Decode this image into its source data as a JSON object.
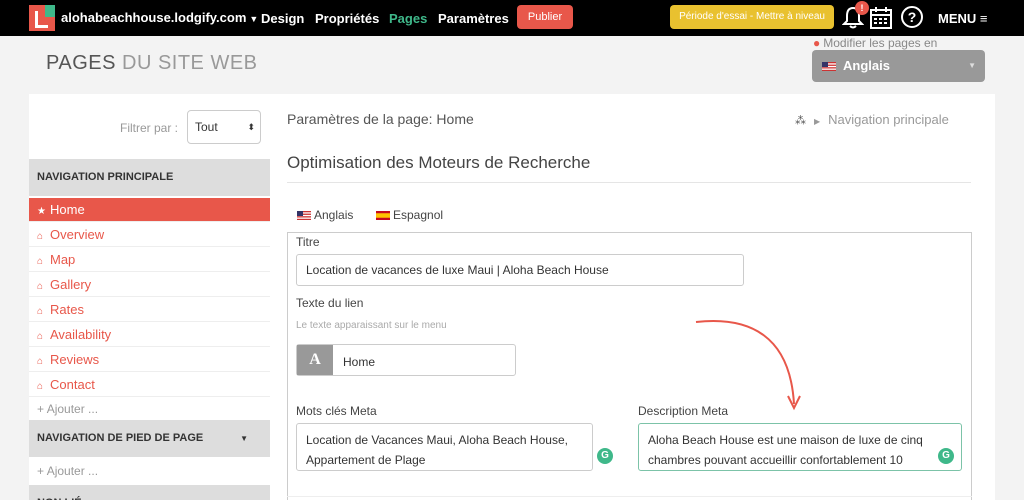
{
  "topbar": {
    "site": "alohabeachhouse.lodgify.com",
    "nav": [
      "Design",
      "Propriétés",
      "Pages",
      "Paramètres"
    ],
    "publish": "Publier",
    "trial": "Période d'essai - Mettre à niveau",
    "notif_count": "!",
    "help": "?",
    "menu": "MENU"
  },
  "header": {
    "title_strong": "PAGES",
    "title_light": "DU SITE WEB",
    "edit_label": "Modifier les pages en",
    "language": "Anglais"
  },
  "sidebar": {
    "filter_label": "Filtrer par :",
    "filter_value": "Tout",
    "main_nav_title": "NAVIGATION PRINCIPALE",
    "main_items": [
      "Home",
      "Overview",
      "Map",
      "Gallery",
      "Rates",
      "Availability",
      "Reviews",
      "Contact"
    ],
    "add_label": "Ajouter ...",
    "footer_nav_title": "NAVIGATION DE PIED DE PAGE",
    "footer_add_label": "Ajouter ...",
    "unlinked_title": "NON LIÉ"
  },
  "main": {
    "breadcrumb": "Paramètres de la page: Home",
    "nav_breadcrumb": "Navigation principale",
    "seo_title": "Optimisation des Moteurs de Recherche",
    "tabs": [
      "Anglais",
      "Espagnol"
    ],
    "title_label": "Titre",
    "title_value": "Location de vacances de luxe Maui | Aloha Beach House",
    "link_label": "Texte du lien",
    "link_hint": "Le texte apparaissant sur le menu",
    "link_value": "Home",
    "keywords_label": "Mots clés Meta",
    "keywords_value": "Location de Vacances Maui, Aloha Beach House, Appartement de Plage",
    "description_label": "Description Meta",
    "description_value": "Aloha Beach House est une maison de luxe de cinq chambres pouvant accueillir confortablement 10"
  },
  "colors": {
    "accent": "#e8574a",
    "green": "#3fb88a",
    "trial": "#e9c12f"
  }
}
